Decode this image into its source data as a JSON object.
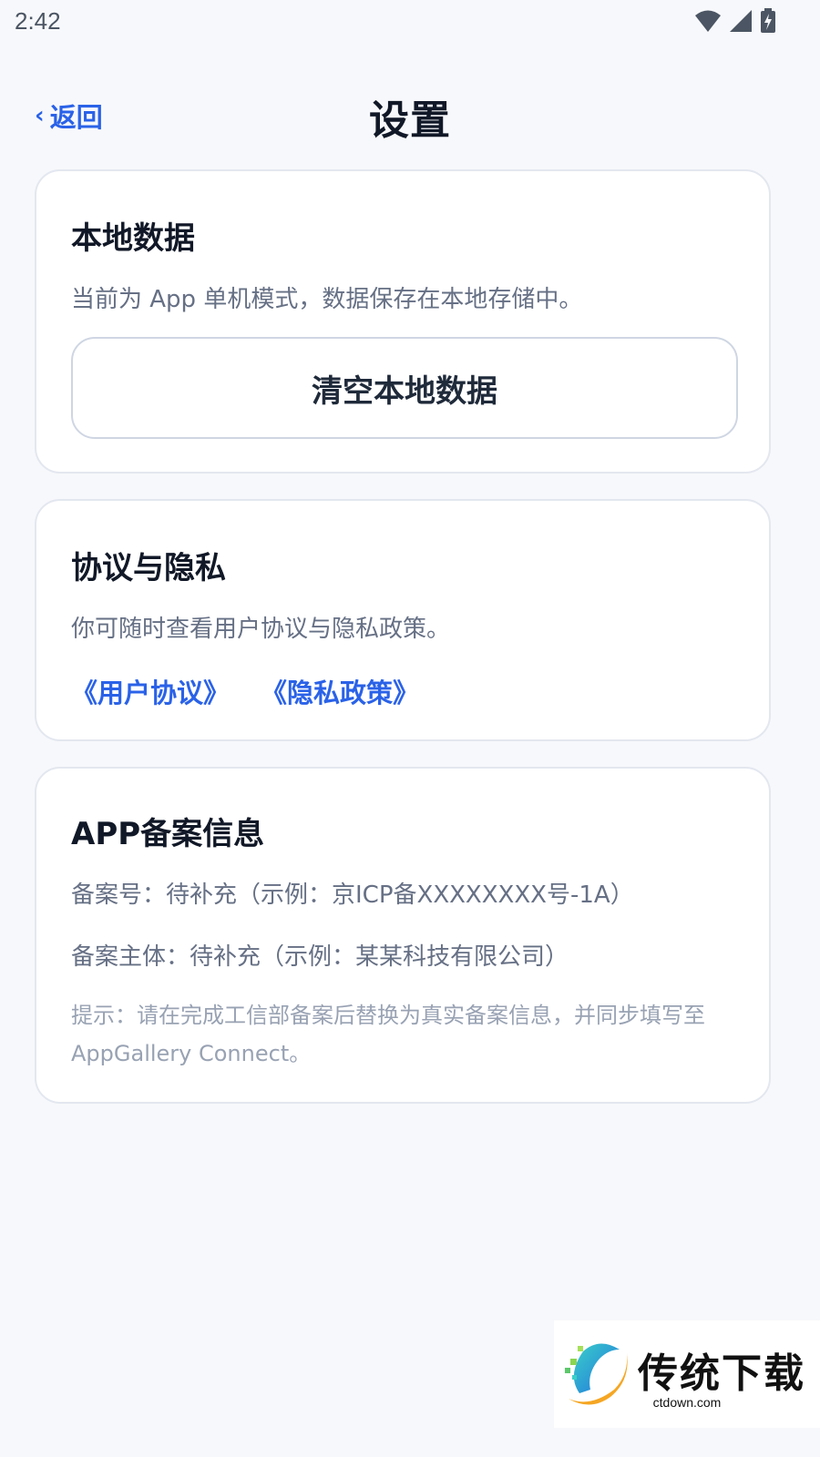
{
  "status_bar": {
    "time": "2:42"
  },
  "nav": {
    "back_label": "返回",
    "title": "设置"
  },
  "local_data": {
    "title": "本地数据",
    "description": "当前为 App 单机模式，数据保存在本地存储中。",
    "clear_button_label": "清空本地数据"
  },
  "privacy": {
    "title": "协议与隐私",
    "description": "你可随时查看用户协议与隐私政策。",
    "user_agreement_link": "《用户协议》",
    "privacy_policy_link": "《隐私政策》"
  },
  "icp": {
    "title": "APP备案信息",
    "number_line": "备案号：待补充（示例：京ICP备XXXXXXXX号-1A）",
    "subject_line": "备案主体：待补充（示例：某某科技有限公司）",
    "hint": "提示：请在完成工信部备案后替换为真实备案信息，并同步填写至 AppGallery Connect。"
  },
  "watermark": {
    "name": "传统下载",
    "domain": "ctdown.com"
  },
  "colors": {
    "accent": "#2a62e8",
    "background": "#f7f8fb",
    "card": "#ffffff",
    "muted_text": "#667085"
  },
  "icons": [
    "wifi-icon",
    "cellular-signal-icon",
    "battery-charging-icon",
    "chevron-left-icon",
    "ctdown-logo-icon"
  ]
}
